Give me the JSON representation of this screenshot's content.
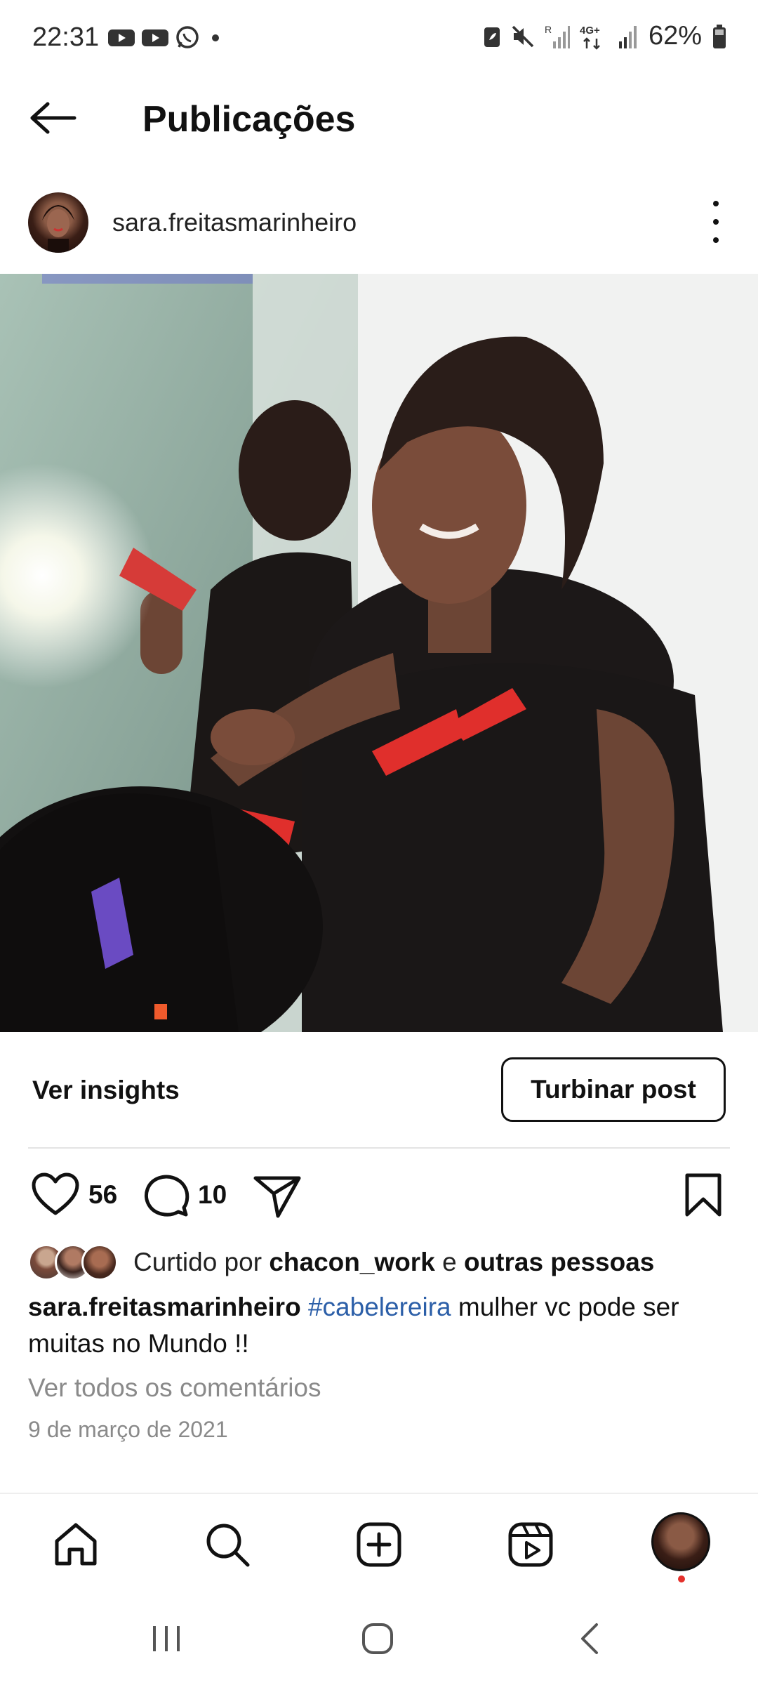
{
  "status_bar": {
    "time": "22:31",
    "battery": "62%",
    "network_label": "4G+",
    "roaming_label": "R"
  },
  "header": {
    "title": "Publicações"
  },
  "post": {
    "username": "sara.freitasmarinheiro",
    "insights_label": "Ver insights",
    "boost_label": "Turbinar post",
    "likes_count": "56",
    "comments_count": "10",
    "liked_by_prefix": "Curtido por",
    "liked_by_user": "chacon_work",
    "liked_by_connector": "e",
    "liked_by_suffix": "outras pessoas",
    "caption_user": "sara.freitasmarinheiro",
    "caption_hashtag": "#cabelereira",
    "caption_text": " mulher  vc pode ser muitas no Mundo !!",
    "view_comments": "Ver todos os comentários",
    "date": "9 de março de 2021"
  },
  "icons": {
    "back": "arrow-left-icon",
    "more": "more-vertical-icon",
    "like": "heart-icon",
    "comment": "comment-icon",
    "share": "send-icon",
    "save": "bookmark-icon",
    "home": "home-icon",
    "search": "search-icon",
    "create": "plus-square-icon",
    "reels": "reels-icon"
  },
  "colors": {
    "hashtag": "#2c5fa8",
    "secondary_text": "#8a8a8a",
    "notification_dot": "#e4302b"
  }
}
